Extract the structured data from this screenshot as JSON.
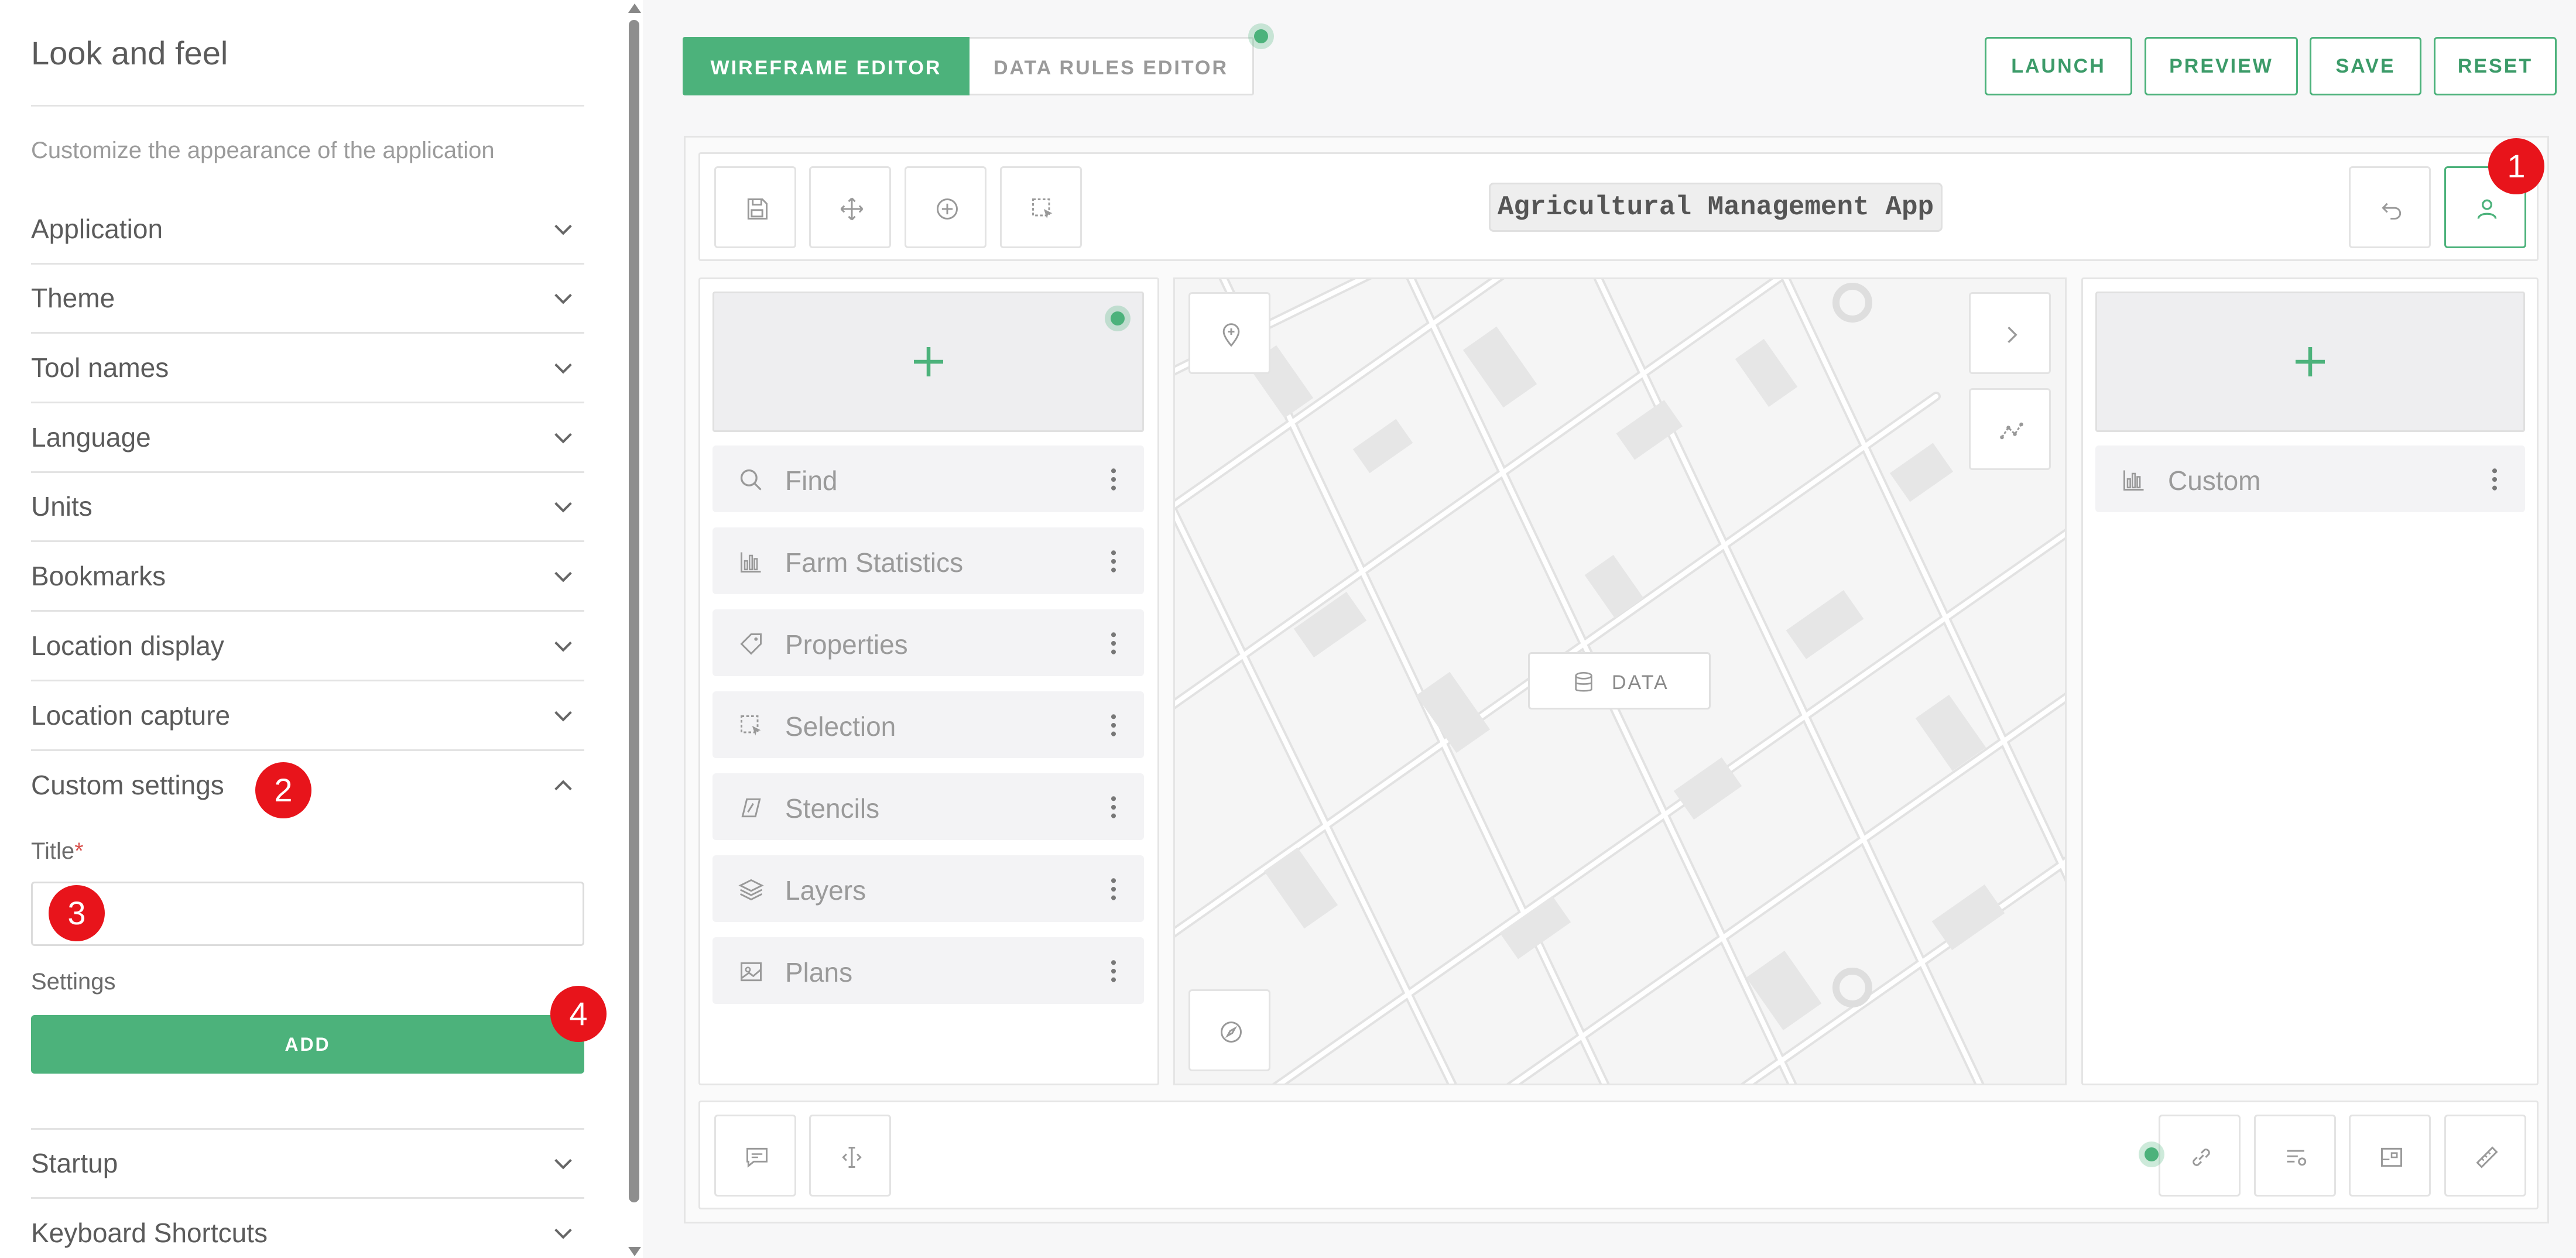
{
  "left_panel": {
    "title": "Look and feel",
    "subtitle": "Customize the appearance of the application",
    "sections": [
      {
        "label": "Application"
      },
      {
        "label": "Theme"
      },
      {
        "label": "Tool names"
      },
      {
        "label": "Language"
      },
      {
        "label": "Units"
      },
      {
        "label": "Bookmarks"
      },
      {
        "label": "Location display"
      },
      {
        "label": "Location capture"
      },
      {
        "label": "Custom settings"
      }
    ],
    "custom_settings": {
      "title_label": "Title",
      "required_mark": "*",
      "title_value": "",
      "settings_label": "Settings",
      "add_label": "ADD"
    },
    "sections_after": [
      {
        "label": "Startup"
      },
      {
        "label": "Keyboard Shortcuts"
      }
    ]
  },
  "top_bar": {
    "tabs": [
      {
        "label": "WIREFRAME EDITOR",
        "active": true
      },
      {
        "label": "DATA RULES EDITOR",
        "active": false
      }
    ],
    "actions": {
      "launch": "LAUNCH",
      "preview": "PREVIEW",
      "save": "SAVE",
      "reset": "RESET"
    }
  },
  "wireframe": {
    "app_title": "Agricultural Management App",
    "left_tools": [
      {
        "label": "Find",
        "icon": "search-icon"
      },
      {
        "label": "Farm Statistics",
        "icon": "bar-chart-icon"
      },
      {
        "label": "Properties",
        "icon": "tag-icon"
      },
      {
        "label": "Selection",
        "icon": "selection-icon"
      },
      {
        "label": "Stencils",
        "icon": "stencil-icon"
      },
      {
        "label": "Layers",
        "icon": "layers-icon"
      },
      {
        "label": "Plans",
        "icon": "image-icon"
      }
    ],
    "right_tools": [
      {
        "label": "Custom",
        "icon": "bar-chart-icon"
      }
    ],
    "map_data_label": "DATA"
  },
  "badges": {
    "b1": "1",
    "b2": "2",
    "b3": "3",
    "b4": "4"
  },
  "colors": {
    "accent": "#4cb27b",
    "badge": "#e8141b"
  }
}
